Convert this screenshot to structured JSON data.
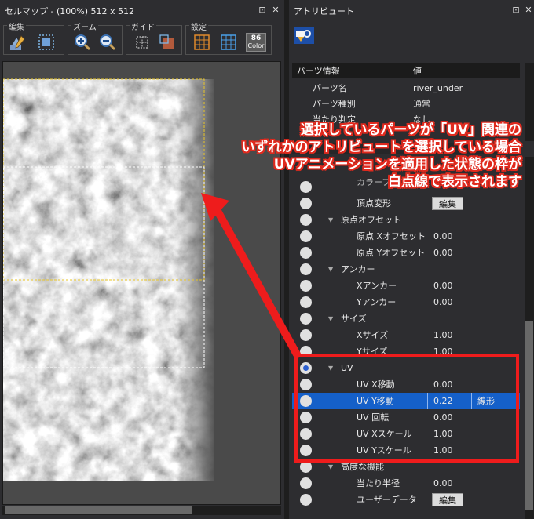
{
  "cellmap": {
    "title": "セルマップ - (100%) 512 x 512",
    "groups": [
      {
        "label": "編集"
      },
      {
        "label": "ズーム"
      },
      {
        "label": "ガイド"
      },
      {
        "label": "設定"
      }
    ],
    "color_button_text": "86",
    "color_button_label": "Color"
  },
  "attributes": {
    "title": "アトリビュート",
    "header": {
      "col1": "パーツ情報",
      "col2": "値"
    },
    "top_rows": [
      {
        "label": "パーツ名",
        "value": "river_under"
      },
      {
        "label": "パーツ種別",
        "value": "通常"
      },
      {
        "label": "当たり判定",
        "value": "なし"
      }
    ],
    "rows": [
      {
        "label": "カラーブレンド",
        "value": "",
        "kind": "partial"
      },
      {
        "label": "頂点変形",
        "button": "編集",
        "kind": "button"
      },
      {
        "label": "原点オフセット",
        "kind": "group"
      },
      {
        "label": "原点 Xオフセット",
        "value": "0.00"
      },
      {
        "label": "原点 Yオフセット",
        "value": "0.00"
      },
      {
        "label": "アンカー",
        "kind": "group"
      },
      {
        "label": "Xアンカー",
        "value": "0.00"
      },
      {
        "label": "Yアンカー",
        "value": "0.00"
      },
      {
        "label": "サイズ",
        "kind": "group"
      },
      {
        "label": "Xサイズ",
        "value": "1.00"
      },
      {
        "label": "Yサイズ",
        "value": "1.00"
      },
      {
        "label": "UV",
        "kind": "group",
        "radio_on": true
      },
      {
        "label": "UV X移動",
        "value": "0.00"
      },
      {
        "label": "UV Y移動",
        "value": "0.22",
        "interp": "線形",
        "selected": true
      },
      {
        "label": "UV 回転",
        "value": "0.00"
      },
      {
        "label": "UV Xスケール",
        "value": "1.00"
      },
      {
        "label": "UV Yスケール",
        "value": "1.00"
      },
      {
        "label": "高度な機能",
        "kind": "group"
      },
      {
        "label": "当たり半径",
        "value": "0.00"
      },
      {
        "label": "ユーザーデータ",
        "button": "編集",
        "kind": "button"
      }
    ]
  },
  "annotation": {
    "lines": [
      "選択しているパーツが「UV」関連の",
      "いずれかのアトリビュートを選択している場合",
      "UVアニメーションを適用した状態の枠が",
      "白点線で表示されます"
    ]
  },
  "colors": {
    "selection": "#1560c9",
    "annotation_red": "#ee1c1c",
    "guide_yellow": "#e8c52a"
  }
}
